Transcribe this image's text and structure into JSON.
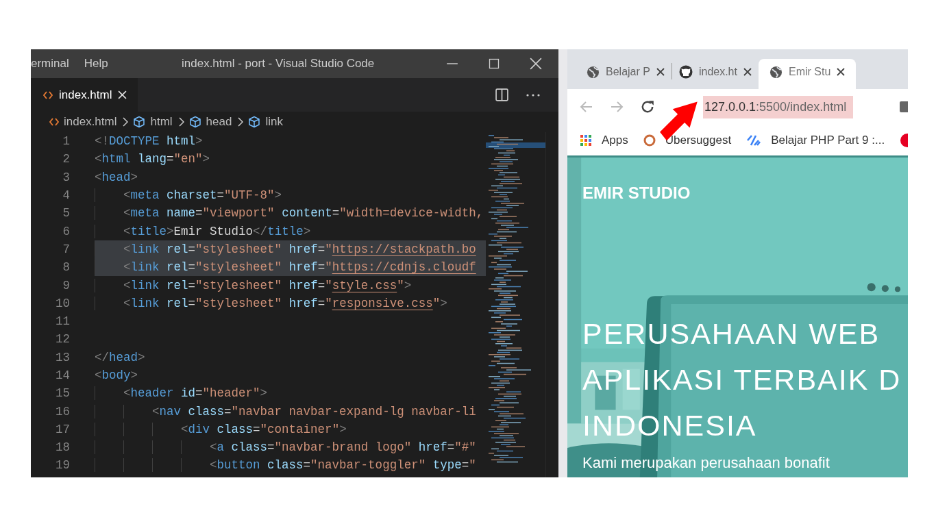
{
  "vscode": {
    "menu": [
      "erminal",
      "Help"
    ],
    "title": "index.html - port - Visual Studio Code",
    "tab": {
      "label": "index.html",
      "selected": true
    },
    "breadcrumb": [
      "index.html",
      "html",
      "head",
      "link"
    ],
    "lines": [
      {
        "n": "1",
        "selected": false,
        "text": "<!DOCTYPE html>"
      },
      {
        "n": "2",
        "selected": false,
        "text": "<html lang=\"en\">"
      },
      {
        "n": "3",
        "selected": false,
        "text": "<head>"
      },
      {
        "n": "4",
        "selected": false,
        "text": "    <meta charset=\"UTF-8\">"
      },
      {
        "n": "5",
        "selected": false,
        "text": "    <meta name=\"viewport\" content=\"width=device-width,"
      },
      {
        "n": "6",
        "selected": false,
        "text": "    <title>Emir Studio</title>"
      },
      {
        "n": "7",
        "selected": true,
        "text": "    <link rel=\"stylesheet\" href=\"https://stackpath.bo"
      },
      {
        "n": "8",
        "selected": true,
        "text": "    <link rel=\"stylesheet\" href=\"https://cdnjs.cloudf"
      },
      {
        "n": "9",
        "selected": false,
        "text": "    <link rel=\"stylesheet\" href=\"style.css\">"
      },
      {
        "n": "10",
        "selected": false,
        "text": "    <link rel=\"stylesheet\" href=\"responsive.css\">"
      },
      {
        "n": "11",
        "selected": false
      },
      {
        "n": "12",
        "selected": false
      },
      {
        "n": "13",
        "selected": false,
        "text": "</head>"
      },
      {
        "n": "14",
        "selected": false,
        "text": "<body>"
      },
      {
        "n": "15",
        "selected": false,
        "text": "    <header id=\"header\">"
      },
      {
        "n": "16",
        "selected": false,
        "text": "        <nav class=\"navbar navbar-expand-lg navbar-li"
      },
      {
        "n": "17",
        "selected": false,
        "text": "            <div class=\"container\">"
      },
      {
        "n": "18",
        "selected": false,
        "text": "                <a class=\"navbar-brand logo\" href=\"#\""
      },
      {
        "n": "19",
        "selected": false,
        "text": "                <button class=\"navbar-toggler\" type=\""
      }
    ]
  },
  "browser": {
    "tabs": [
      {
        "label": "Belajar P",
        "selected": false
      },
      {
        "label": "index.ht",
        "selected": false
      },
      {
        "label": "Emir Stu",
        "selected": true
      }
    ],
    "address": {
      "host": "127.0.0.1",
      "rest": ":5500/index.html",
      "selected": true
    },
    "bookmarks": [
      "Apps",
      "Ubersuggest",
      "Belajar PHP Part 9 :..."
    ],
    "page": {
      "brand": "EMIR STUDIO",
      "heading_lines": [
        "PERUSAHAAN WEB",
        "APLIKASI TERBAIK D",
        "INDONESIA"
      ],
      "text": "Kami merupakan perusahaan bonafit"
    }
  }
}
